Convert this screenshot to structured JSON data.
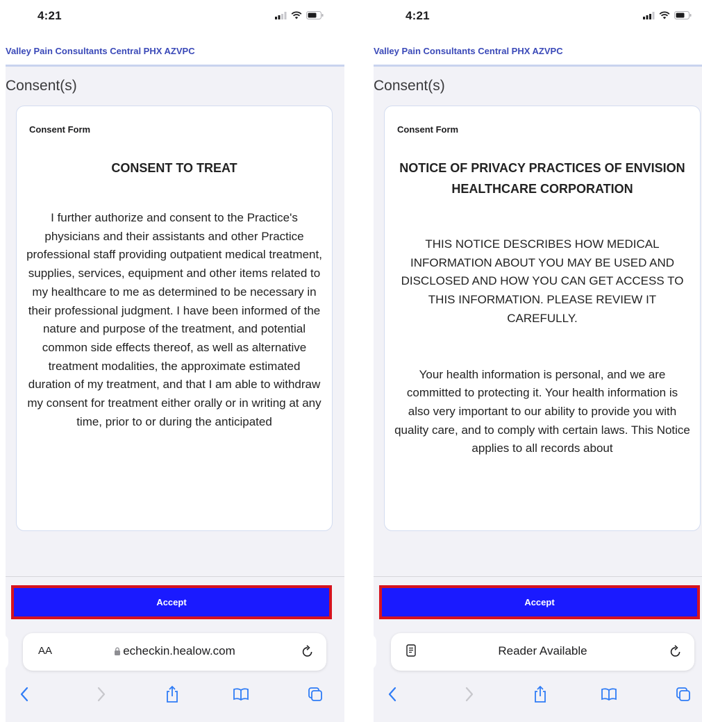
{
  "screens": [
    {
      "status_time": "4:21",
      "app_title": "Valley Pain Consultants Central PHX AZVPC",
      "section_title": "Consent(s)",
      "card_label": "Consent Form",
      "doc_heading": "CONSENT TO TREAT",
      "doc_paragraph": "I further authorize and consent to the Practice's physicians and their assistants and other Practice professional staff providing outpatient medical treatment, supplies, services, equipment and other items related to my healthcare to me as determined to be necessary in their professional judgment. I have been informed of the nature and purpose of the treatment, and potential common side effects thereof, as well as alternative treatment modalities, the approximate estimated duration of my treatment, and that I am able to withdraw my consent for treatment either orally or in writing at any time, prior to or during the anticipated",
      "accept_label": "Accept",
      "url_bar": {
        "aa_label": "AA",
        "url_text": "echeckin.healow.com"
      }
    },
    {
      "status_time": "4:21",
      "app_title": "Valley Pain Consultants Central PHX AZVPC",
      "section_title": "Consent(s)",
      "card_label": "Consent Form",
      "doc_heading": "NOTICE OF PRIVACY PRACTICES OF ENVISION HEALTHCARE CORPORATION",
      "doc_paragraph_1": "THIS NOTICE DESCRIBES HOW MEDICAL INFORMATION ABOUT YOU MAY BE USED AND DISCLOSED AND HOW YOU CAN GET ACCESS TO THIS INFORMATION. PLEASE REVIEW IT CAREFULLY.",
      "doc_paragraph_2": "Your health information is personal, and we are committed to protecting it. Your health information is also very important to our ability to provide you with quality care, and to comply with certain laws. This Notice applies to all records about",
      "accept_label": "Accept",
      "url_bar": {
        "reader_label": "Reader Available"
      }
    }
  ],
  "colors": {
    "accent_blue": "#1a1aff",
    "highlight_red": "#d6131f",
    "header_text": "#3a49b8",
    "ios_blue": "#2f7cf6"
  },
  "icons": [
    "signal-icon",
    "wifi-icon",
    "battery-icon",
    "lock-icon",
    "reload-icon",
    "reader-icon",
    "back-icon",
    "forward-icon",
    "share-icon",
    "bookmarks-icon",
    "tabs-icon"
  ]
}
